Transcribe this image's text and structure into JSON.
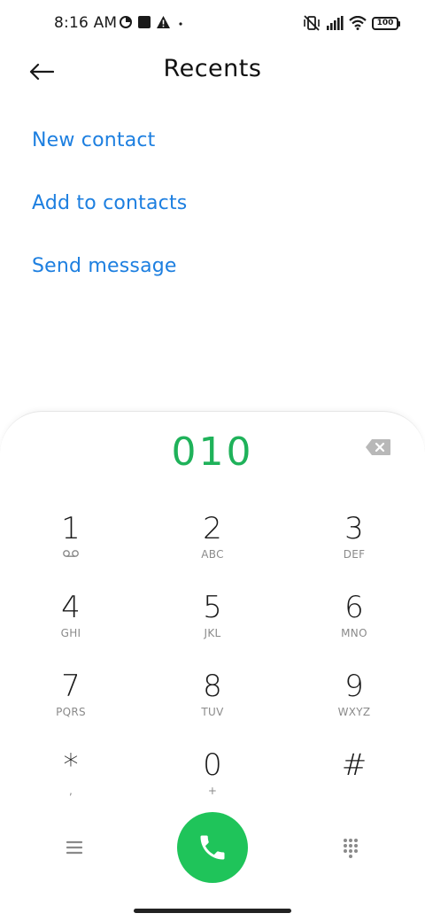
{
  "status_bar": {
    "time": "8:16 AM",
    "left_icons": [
      "data-saver-icon",
      "square-notification-icon",
      "alert-icon",
      "dot-icon"
    ],
    "right_icons": [
      "vibrate-off-icon",
      "signal-icon",
      "wifi-icon",
      "battery-icon"
    ],
    "battery_level": "100"
  },
  "header": {
    "back_icon": "back-arrow-icon",
    "title": "Recents"
  },
  "actions": [
    {
      "label": "New contact"
    },
    {
      "label": "Add to contacts"
    },
    {
      "label": "Send message"
    }
  ],
  "dialer": {
    "number": "010",
    "keys": [
      {
        "digit": "1",
        "letters": ""
      },
      {
        "digit": "2",
        "letters": "ABC"
      },
      {
        "digit": "3",
        "letters": "DEF"
      },
      {
        "digit": "4",
        "letters": "GHI"
      },
      {
        "digit": "5",
        "letters": "JKL"
      },
      {
        "digit": "6",
        "letters": "MNO"
      },
      {
        "digit": "7",
        "letters": "PQRS"
      },
      {
        "digit": "8",
        "letters": "TUV"
      },
      {
        "digit": "9",
        "letters": "WXYZ"
      },
      {
        "digit": "*",
        "letters": ","
      },
      {
        "digit": "0",
        "letters": "+"
      },
      {
        "digit": "#",
        "letters": ""
      }
    ]
  },
  "colors": {
    "accent_link": "#1d7fe0",
    "dial_number": "#1fb25a",
    "call_button": "#1fc45a"
  }
}
